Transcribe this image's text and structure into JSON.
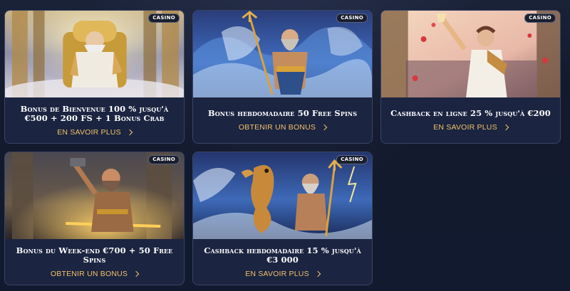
{
  "cards": [
    {
      "badge": "CASINO",
      "title": "Bonus de Bienvenue 100 % jusqu'à €500 + 200 FS + 1 Bonus Crab",
      "cta": "EN SAVOIR PLUS",
      "image_icon": "zeus-throne-icon"
    },
    {
      "badge": "CASINO",
      "title": "Bonus hebdomadaire 50 Free Spins",
      "cta": "OBTENIR UN BONUS",
      "image_icon": "poseidon-trident-icon"
    },
    {
      "badge": "CASINO",
      "title": "Cashback en ligne 25 % jusqu'à €200",
      "cta": "EN SAVOIR PLUS",
      "image_icon": "dionysus-celebration-icon"
    },
    {
      "badge": "CASINO",
      "title": "Bonus du Week-end €700 + 50 Free Spins",
      "cta": "OBTENIR UN BONUS",
      "image_icon": "hephaestus-hammer-icon"
    },
    {
      "badge": "CASINO",
      "title": "Cashback hebdomadaire 15 % jusqu'à €3 000",
      "cta": "EN SAVOIR PLUS",
      "image_icon": "poseidon-seahorse-icon"
    }
  ],
  "colors": {
    "page_bg": "#121a2f",
    "card_bg": "#1b2440",
    "card_border": "#3a4565",
    "cta": "#f2c26a",
    "title": "#ffffff"
  }
}
